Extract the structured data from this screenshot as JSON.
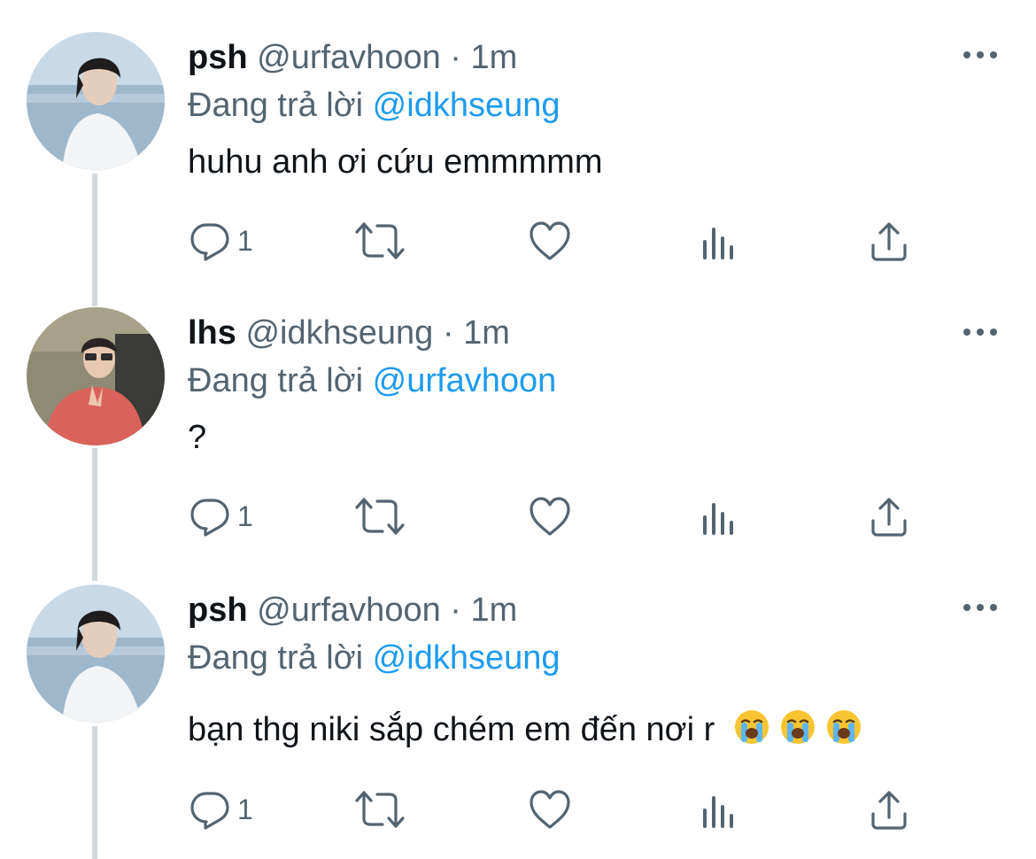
{
  "tweets": [
    {
      "name": "psh",
      "handle": "@urfavhoon",
      "separator": "·",
      "time": "1m",
      "reply_prefix": "Đang trả lời",
      "reply_to": "@idkhseung",
      "text": "huhu anh ơi cứu emmmmm",
      "emoji": [],
      "reply_count": "1"
    },
    {
      "name": "lhs",
      "handle": "@idkhseung",
      "separator": "·",
      "time": "1m",
      "reply_prefix": "Đang trả lời",
      "reply_to": "@urfavhoon",
      "text": "?",
      "emoji": [],
      "reply_count": "1"
    },
    {
      "name": "psh",
      "handle": "@urfavhoon",
      "separator": "·",
      "time": "1m",
      "reply_prefix": "Đang trả lời",
      "reply_to": "@idkhseung",
      "text": "bạn thg niki sắp chém em đến nơi r",
      "emoji": [
        "loudly-crying-face-emoji",
        "loudly-crying-face-emoji",
        "loudly-crying-face-emoji"
      ],
      "reply_count": "1"
    }
  ],
  "icons": [
    "reply-icon",
    "retweet-icon",
    "like-icon",
    "views-icon",
    "share-icon",
    "more-icon"
  ],
  "colors": {
    "accent": "#1d9bf0",
    "secondary_text": "#536471",
    "primary_text": "#0f1419",
    "thread_line": "#cfd9de"
  }
}
